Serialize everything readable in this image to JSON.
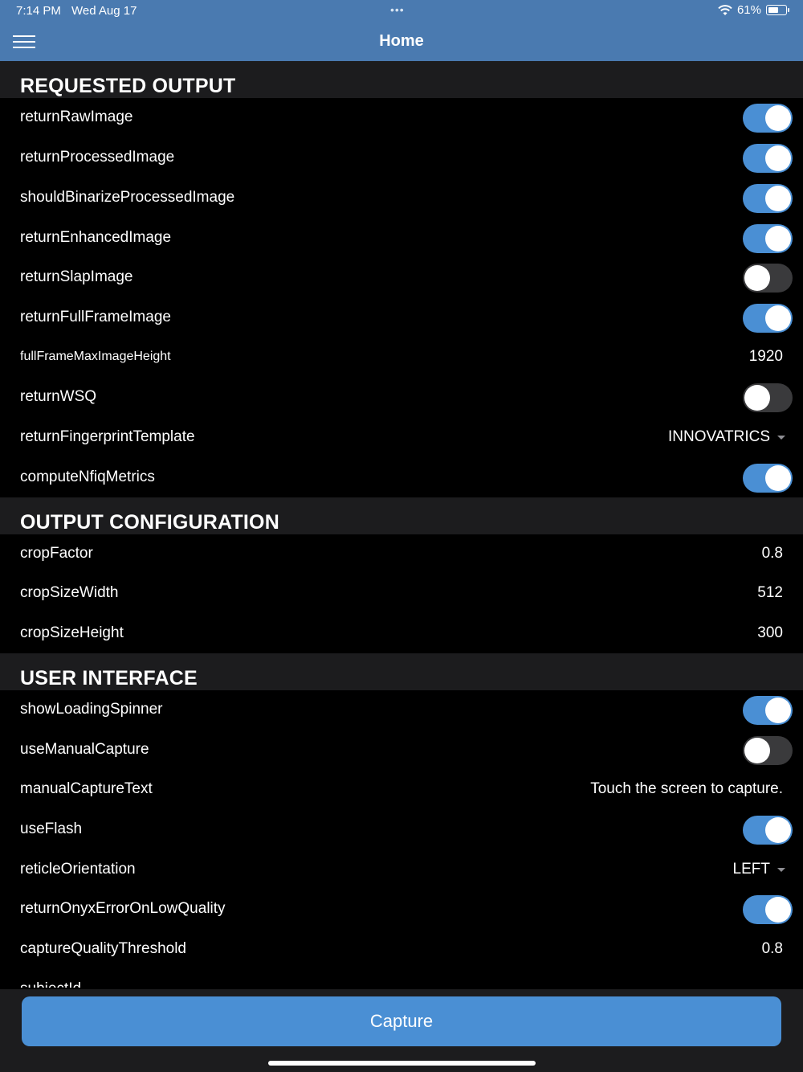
{
  "status": {
    "time": "7:14 PM",
    "date": "Wed Aug 17",
    "dots": "•••",
    "battery_text": "61%",
    "battery_level": 0.61
  },
  "nav": {
    "title": "Home"
  },
  "sections": {
    "requested_output": "REQUESTED OUTPUT",
    "output_configuration": "OUTPUT CONFIGURATION",
    "user_interface": "USER INTERFACE"
  },
  "rows": {
    "returnRawImage": {
      "label": "returnRawImage",
      "on": true
    },
    "returnProcessedImage": {
      "label": "returnProcessedImage",
      "on": true
    },
    "shouldBinarizeProcessedImage": {
      "label": "shouldBinarizeProcessedImage",
      "on": true
    },
    "returnEnhancedImage": {
      "label": "returnEnhancedImage",
      "on": true
    },
    "returnSlapImage": {
      "label": "returnSlapImage",
      "on": false
    },
    "returnFullFrameImage": {
      "label": "returnFullFrameImage",
      "on": true
    },
    "fullFrameMaxImageHeight": {
      "label": "fullFrameMaxImageHeight",
      "value": "1920"
    },
    "returnWSQ": {
      "label": "returnWSQ",
      "on": false
    },
    "returnFingerprintTemplate": {
      "label": "returnFingerprintTemplate",
      "value": "INNOVATRICS"
    },
    "computeNfiqMetrics": {
      "label": "computeNfiqMetrics",
      "on": true
    },
    "cropFactor": {
      "label": "cropFactor",
      "value": "0.8"
    },
    "cropSizeWidth": {
      "label": "cropSizeWidth",
      "value": "512"
    },
    "cropSizeHeight": {
      "label": "cropSizeHeight",
      "value": "300"
    },
    "showLoadingSpinner": {
      "label": "showLoadingSpinner",
      "on": true
    },
    "useManualCapture": {
      "label": "useManualCapture",
      "on": false
    },
    "manualCaptureText": {
      "label": "manualCaptureText",
      "value": "Touch the screen to capture."
    },
    "useFlash": {
      "label": "useFlash",
      "on": true
    },
    "reticleOrientation": {
      "label": "reticleOrientation",
      "value": "LEFT"
    },
    "returnOnyxErrorOnLowQuality": {
      "label": "returnOnyxErrorOnLowQuality",
      "on": true
    },
    "captureQualityThreshold": {
      "label": "captureQualityThreshold",
      "value": "0.8"
    },
    "subjectId": {
      "label": "subjectId"
    }
  },
  "capture_button": {
    "label": "Capture"
  },
  "colors": {
    "nav_bar": "#4a7ab0",
    "toggle_on": "#4a8fd4",
    "toggle_off": "#3a3a3c",
    "section_bg": "#1c1c1e",
    "button": "#4a8fd4"
  }
}
